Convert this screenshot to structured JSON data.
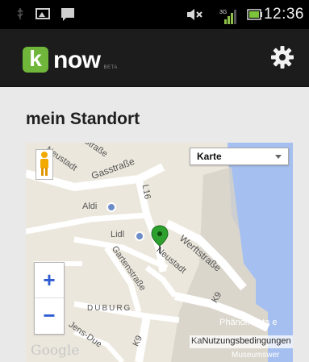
{
  "status_bar": {
    "time": "12:36",
    "signal_label": "3G",
    "icons": [
      "usb-icon",
      "image-icon",
      "message-icon",
      "mute-icon",
      "signal-icon",
      "battery-icon"
    ]
  },
  "app_bar": {
    "logo_k": "k",
    "logo_now": "now",
    "logo_beta": "BETA",
    "settings_icon": "gear-icon",
    "bg_color": "#1c1c1c",
    "brand_color": "#6fb63a"
  },
  "page": {
    "title": "mein Standort"
  },
  "map": {
    "map_type_selected": "Karte",
    "zoom_in": "+",
    "zoom_out": "−",
    "terms": "Nutzungsbedingungen",
    "terms_prefix": "Ka",
    "google": "Google",
    "labels": {
      "gasstrasse": "Gasstraße",
      "strasse_top": "Straße",
      "neustadt_top": "Neustadt",
      "l16": "L16",
      "aldi": "Aldi",
      "lidl": "Lidl",
      "werftstrasse": "Werftstraße",
      "neustadt": "Neustadt",
      "gartenstrasse": "Gartenstraße",
      "duburg": "DUBURG",
      "k9_right": "K9",
      "k9_bottom": "K9",
      "jens_due": "Jens-Due",
      "phaenomenta": "Phänomenta e",
      "museumswerft": "Museumswer"
    },
    "water_color": "#a5bff0",
    "marker_color": "#2ea02e"
  }
}
